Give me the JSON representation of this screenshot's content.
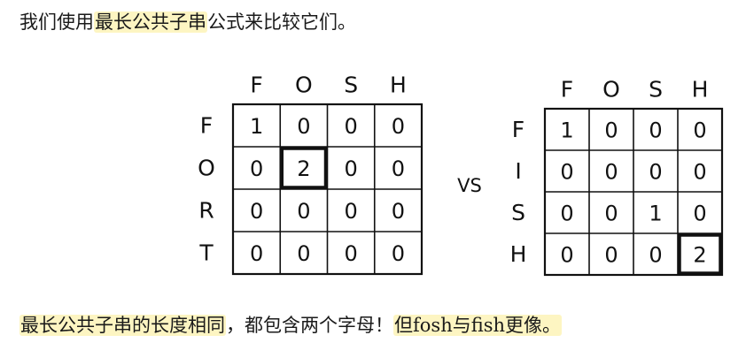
{
  "intro": {
    "before": "我们使用",
    "highlight": "最长公共子串",
    "after": "公式来比较它们。"
  },
  "grids": [
    {
      "col_headers": [
        "F",
        "O",
        "S",
        "H"
      ],
      "row_headers": [
        "F",
        "O",
        "R",
        "T"
      ],
      "cells": [
        [
          "1",
          "0",
          "0",
          "0"
        ],
        [
          "0",
          "2",
          "0",
          "0"
        ],
        [
          "0",
          "0",
          "0",
          "0"
        ],
        [
          "0",
          "0",
          "0",
          "0"
        ]
      ],
      "bold_cell": [
        1,
        1
      ]
    },
    {
      "col_headers": [
        "F",
        "O",
        "S",
        "H"
      ],
      "row_headers": [
        "F",
        "I",
        "S",
        "H"
      ],
      "cells": [
        [
          "1",
          "0",
          "0",
          "0"
        ],
        [
          "0",
          "0",
          "0",
          "0"
        ],
        [
          "0",
          "0",
          "1",
          "0"
        ],
        [
          "0",
          "0",
          "0",
          "2"
        ]
      ],
      "bold_cell": [
        3,
        3
      ]
    }
  ],
  "vs_label": "VS",
  "conclusion": {
    "highlight1": "最长公共子串的长度相同",
    "middle": "，都包含两个字母！",
    "highlight2": "但fosh与fish更像。"
  }
}
